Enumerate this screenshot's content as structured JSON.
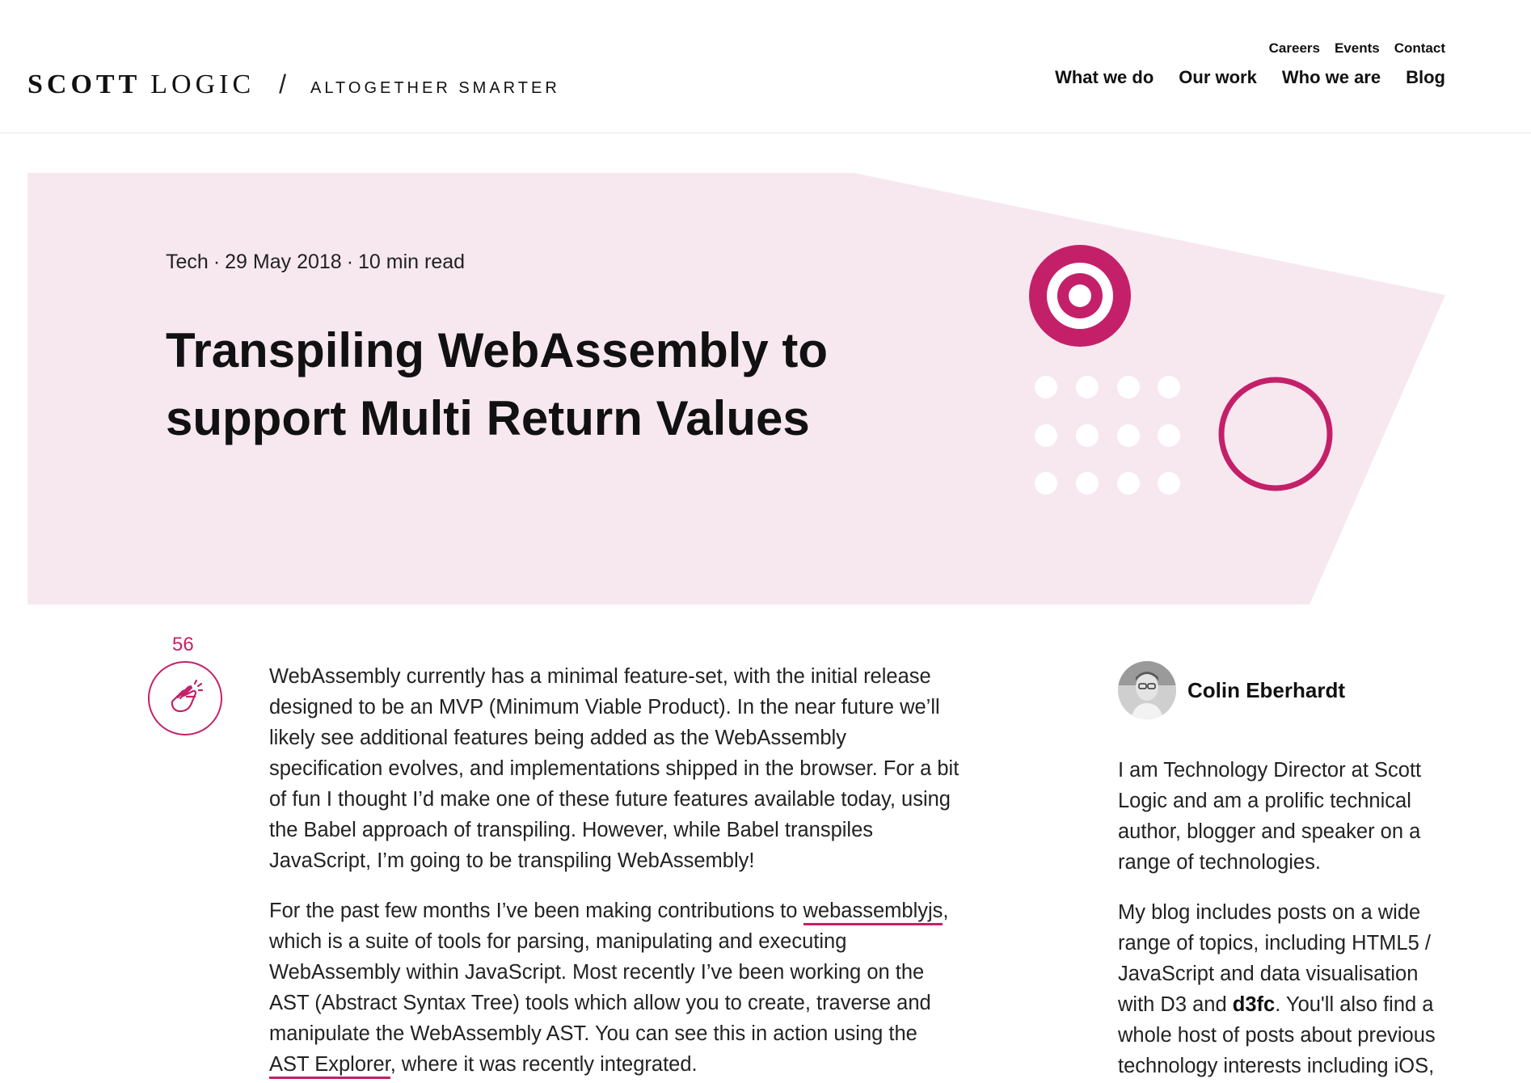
{
  "header": {
    "logo": {
      "scott": "SCOTT",
      "logic": "LOGIC",
      "slash": "/",
      "tagline": "ALTOGETHER SMARTER"
    },
    "secondary_nav": [
      "Careers",
      "Events",
      "Contact"
    ],
    "primary_nav": [
      "What we do",
      "Our work",
      "Who we are",
      "Blog"
    ]
  },
  "hero": {
    "category": "Tech",
    "date": "29 May 2018",
    "read_time": "10 min read",
    "separator": "·",
    "title": "Transpiling WebAssembly to support Multi Return Values"
  },
  "clap": {
    "count": "56"
  },
  "article": {
    "p1": "WebAssembly currently has a minimal feature-set, with the initial release designed to be an MVP (Minimum Viable Product). In the near future we’ll likely see additional features being added as the WebAssembly specification evolves, and implementations shipped in the browser. For a bit of fun I thought I’d make one of these future features available today, using the Babel approach of transpiling. However, while Babel transpiles JavaScript, I’m going to be transpiling WebAssembly!",
    "p2_before": "For the past few months I’ve been making contributions to ",
    "p2_link1": "webassemblyjs",
    "p2_middle": ", which is a suite of tools for parsing, manipulating and executing WebAssembly within JavaScript. Most recently I’ve been working on the AST (Abstract Syntax Tree) tools which allow you to create, traverse and manipulate the WebAssembly AST. You can see this in action using the ",
    "p2_link2": "AST Explorer",
    "p2_after": ", where it was recently integrated."
  },
  "author": {
    "name": "Colin Eberhardt",
    "bio1": "I am Technology Director at Scott Logic and am a prolific technical author, blogger and speaker on a range of technologies.",
    "bio2_before": "My blog includes posts on a wide range of topics, including HTML5 / JavaScript and data visualisation with D3 and ",
    "bio2_bold": "d3fc",
    "bio2_after": ". You'll also find a whole host of posts about previous technology interests including iOS,"
  },
  "colors": {
    "accent": "#c4206a",
    "hero_bg": "#f7e8ef",
    "text": "#222222"
  },
  "icons": [
    "clap-icon",
    "target-decoration",
    "dot-grid-decoration",
    "ring-decoration"
  ]
}
